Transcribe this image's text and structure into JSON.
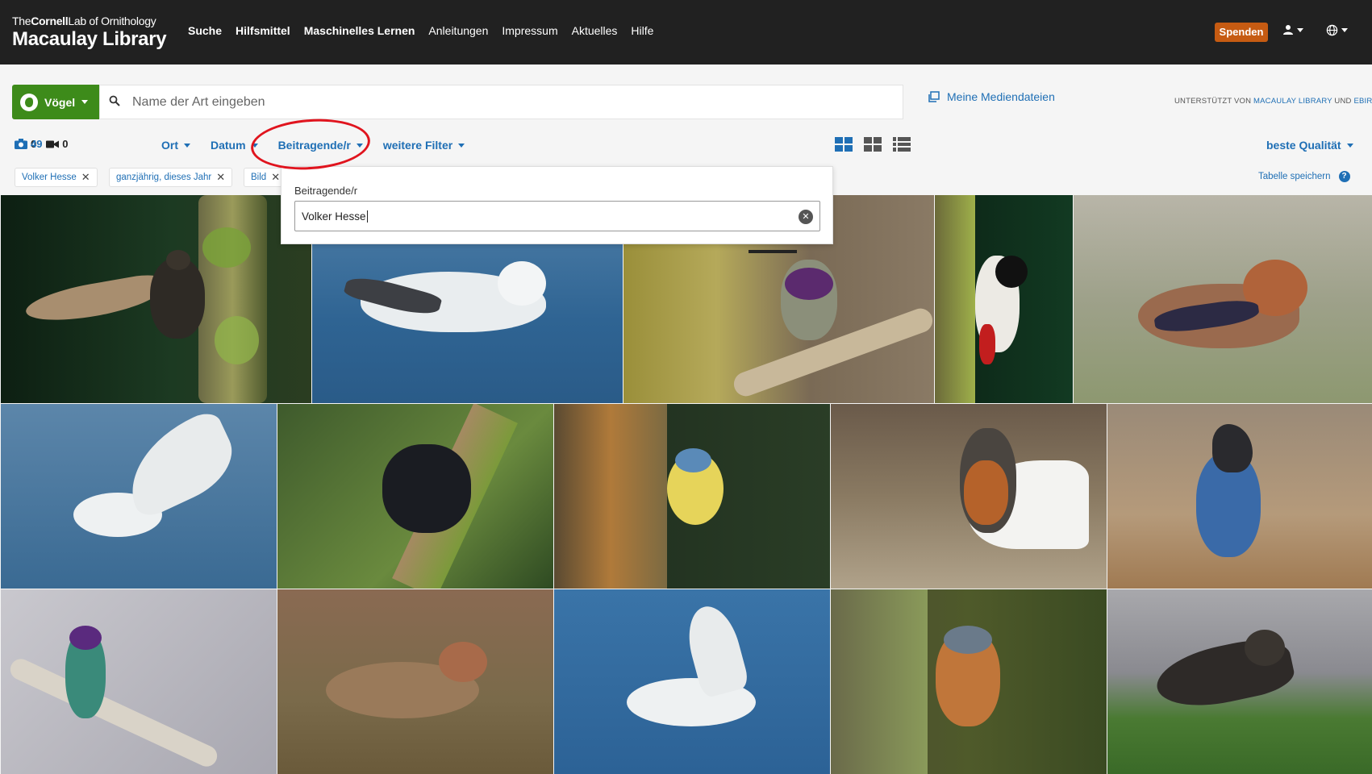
{
  "header": {
    "logo_line1_a": "The",
    "logo_line1_b": "Cornell",
    "logo_line1_c": "Lab",
    "logo_line1_d": " of Ornithology",
    "logo_main": "Macaulay Library",
    "nav": [
      {
        "label": "Suche",
        "bold": true
      },
      {
        "label": "Hilfsmittel",
        "bold": true
      },
      {
        "label": "Maschinelles Lernen",
        "bold": true
      },
      {
        "label": "Anleitungen",
        "bold": false
      },
      {
        "label": "Impressum",
        "bold": false
      },
      {
        "label": "Aktuelles",
        "bold": false
      },
      {
        "label": "Hilfe",
        "bold": false
      }
    ],
    "donate_label": "Spenden",
    "donate_color": "#c65b12",
    "user_icon": "user-icon",
    "language_icon": "globe-icon"
  },
  "search": {
    "taxon_label": "Vögel",
    "taxon_color": "#3d8b1a",
    "placeholder": "Name der Art eingeben",
    "value": "",
    "my_media_label": "Meine Mediendateien",
    "powered_prefix": "UNTERSTÜTZT VON ",
    "powered_link1": "MACAULAY LIBRARY",
    "powered_and": " UND ",
    "powered_link2": "EBIRD"
  },
  "counts": {
    "photos": "49",
    "audio": "0",
    "video": "0"
  },
  "filters": {
    "items": [
      "Ort",
      "Datum",
      "Beitragende/r",
      "weitere Filter"
    ],
    "sort_label": "beste Qualität"
  },
  "chips": [
    "Volker Hesse",
    "ganzjährig, dieses Jahr",
    "Bild"
  ],
  "save_table_label": "Tabelle speichern",
  "dropdown": {
    "label": "Beitragende/r",
    "value": "Volker Hesse"
  },
  "accent_color": "#1f6fb5",
  "annotation_color": "#e0141e"
}
